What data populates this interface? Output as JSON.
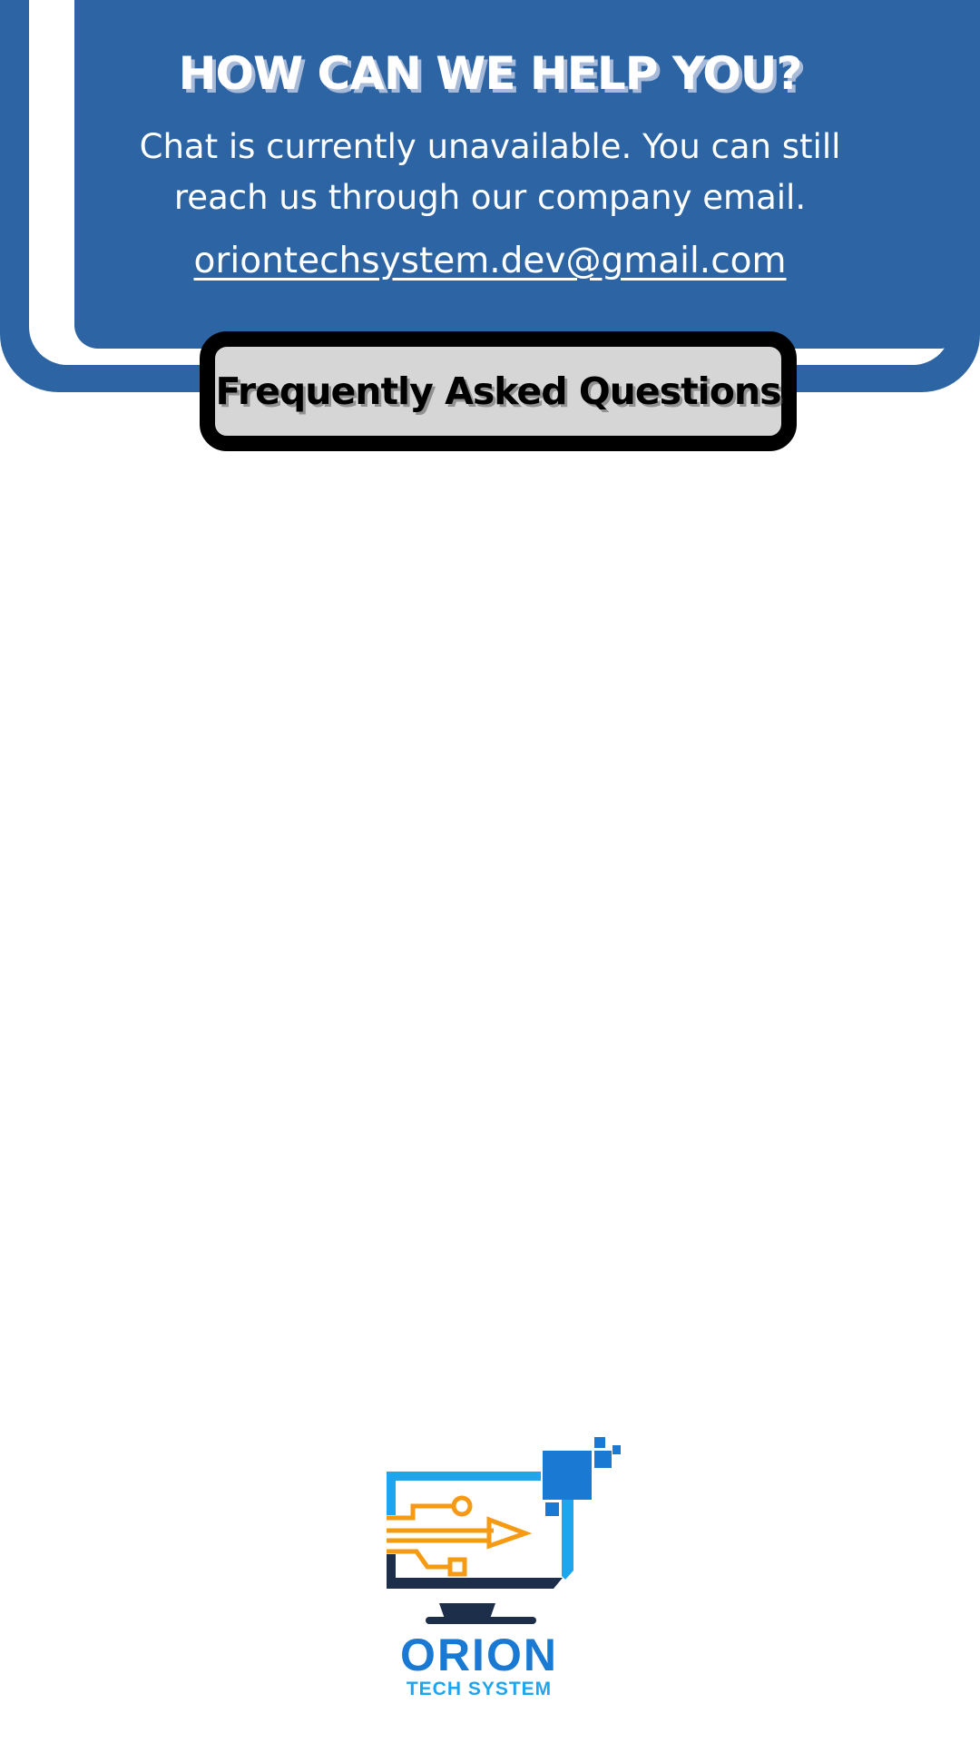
{
  "help": {
    "title": "HOW CAN WE HELP YOU?",
    "message": "Chat is currently unavailable. You can still reach us through our company email.",
    "email": "oriontechsystem.dev@gmail.com"
  },
  "faq_button": {
    "label": "Frequently Asked Questions"
  },
  "logo": {
    "icon": "monitor-circuit-icon",
    "wordmark": "ORION",
    "tagline": "TECH SYSTEM"
  },
  "colors": {
    "banner_blue": "#2d64a3",
    "faq_button_fill": "#d6d6d6",
    "faq_button_border": "#000000",
    "logo_blue": "#1a79d2",
    "logo_light_blue": "#1fa5ee",
    "logo_orange": "#f59a12",
    "logo_navy": "#1d2e4a"
  }
}
